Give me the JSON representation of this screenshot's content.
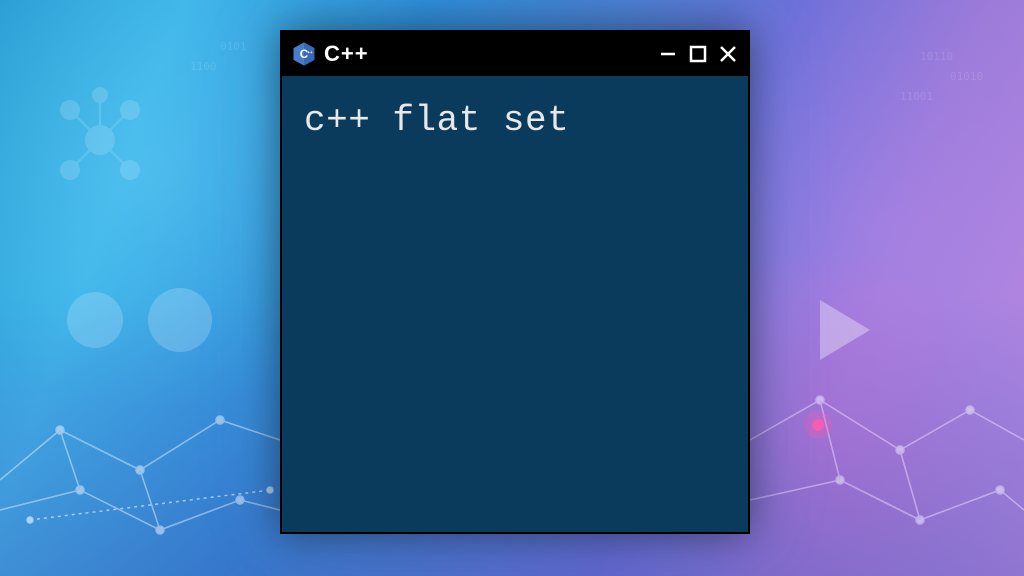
{
  "window": {
    "title": "C++",
    "content": "c++ flat set"
  },
  "icons": {
    "logo": "cpp-logo",
    "minimize": "minimize",
    "maximize": "maximize",
    "close": "close"
  }
}
